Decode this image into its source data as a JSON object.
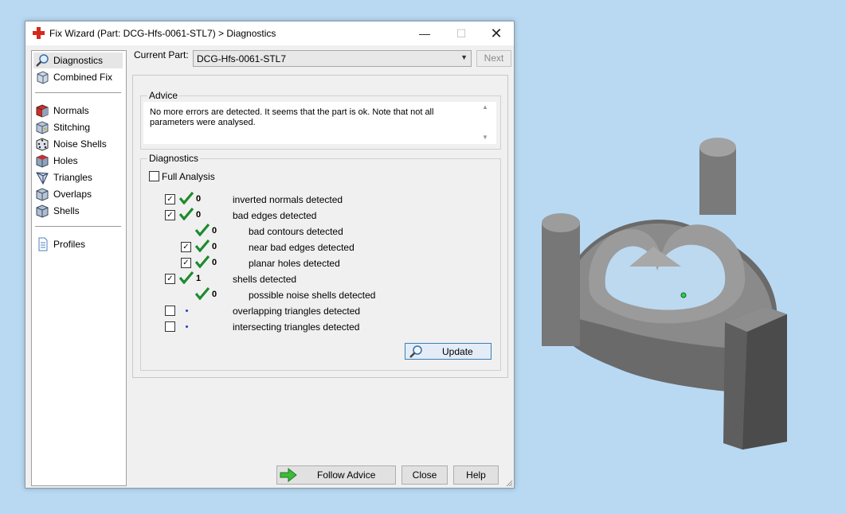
{
  "window": {
    "title": "Fix Wizard (Part: DCG-Hfs-0061-STL7) > Diagnostics",
    "controls": {
      "minimize": "—",
      "maximize": "☐",
      "close": "✕"
    }
  },
  "sidebar": {
    "items": [
      {
        "label": "Diagnostics",
        "icon": "magnifier-icon",
        "selected": true
      },
      {
        "label": "Combined Fix",
        "icon": "cube-icon"
      },
      {
        "label": "Normals",
        "icon": "normals-cube-icon"
      },
      {
        "label": "Stitching",
        "icon": "stitching-icon"
      },
      {
        "label": "Noise Shells",
        "icon": "dice-icon"
      },
      {
        "label": "Holes",
        "icon": "holes-cube-icon"
      },
      {
        "label": "Triangles",
        "icon": "triangles-icon"
      },
      {
        "label": "Overlaps",
        "icon": "overlaps-icon"
      },
      {
        "label": "Shells",
        "icon": "shells-icon"
      },
      {
        "label": "Profiles",
        "icon": "document-icon"
      }
    ]
  },
  "current_part": {
    "label": "Current Part:",
    "value": "DCG-Hfs-0061-STL7",
    "next_label": "Next"
  },
  "advice": {
    "title": "Advice",
    "text": "No more errors are detected. It seems that the part is ok. Note that not all parameters were analysed."
  },
  "diagnostics": {
    "title": "Diagnostics",
    "full_analysis_label": "Full Analysis",
    "rows": [
      {
        "checked": true,
        "status": "ok",
        "count": "0",
        "label": "inverted normals detected"
      },
      {
        "checked": true,
        "status": "ok",
        "count": "0",
        "label": "bad edges detected"
      },
      {
        "checked": null,
        "status": "ok",
        "count": "0",
        "label": "bad contours detected"
      },
      {
        "checked": true,
        "status": "ok",
        "count": "0",
        "label": "near bad edges detected"
      },
      {
        "checked": true,
        "status": "ok",
        "count": "0",
        "label": "planar holes detected"
      },
      {
        "checked": true,
        "status": "ok",
        "count": "1",
        "label": "shells detected"
      },
      {
        "checked": null,
        "status": "ok",
        "count": "0",
        "label": "possible noise shells detected"
      },
      {
        "checked": false,
        "status": "not-run",
        "count": "",
        "label": "overlapping triangles detected"
      },
      {
        "checked": false,
        "status": "not-run",
        "count": "",
        "label": "intersecting triangles detected"
      }
    ],
    "update_label": "Update"
  },
  "buttons": {
    "follow_advice": "Follow Advice",
    "close": "Close",
    "help": "Help"
  },
  "colors": {
    "desktop": "#b9d9f3",
    "ok_tick": "#1e8a2e",
    "not_run_dot": "#1f3fc9",
    "model": "#7d7d7d"
  }
}
